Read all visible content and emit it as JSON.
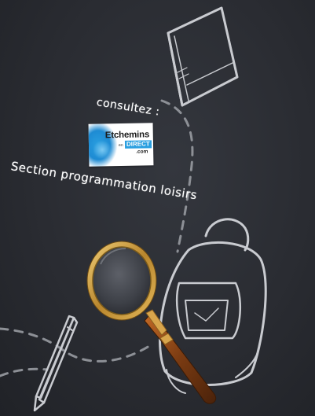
{
  "poster": {
    "consultez_text": "consultez :",
    "section_text": "Section programmation loisirs",
    "logo": {
      "name": "Etchemins",
      "connector": "en",
      "direct": "DIRECT",
      "domain": ".com"
    }
  },
  "colors": {
    "background": "#2b2d33",
    "chalk": "#c9cbd0",
    "text": "#ffffff",
    "logo_blue": "#2a9fe0",
    "magnifier_rim": "#c99a3a",
    "magnifier_handle": "#7a3b12"
  },
  "icons": [
    "book-icon",
    "backpack-icon",
    "pencil-icon",
    "magnifying-glass-icon"
  ]
}
